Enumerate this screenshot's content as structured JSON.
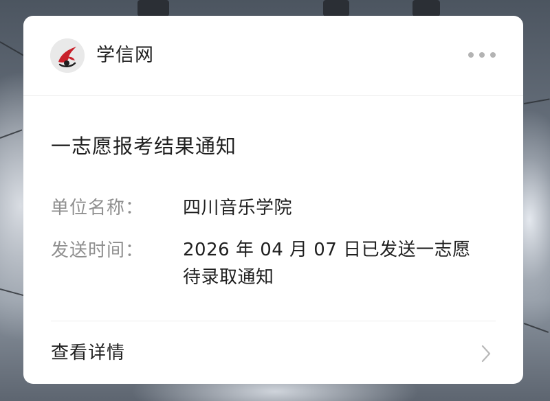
{
  "card": {
    "brand_name": "学信网",
    "more_icon": "more-dots-icon",
    "title": "一志愿报考结果通知",
    "fields": [
      {
        "label": "单位名称：",
        "value_lines": [
          "四川音乐学院"
        ]
      },
      {
        "label": "发送时间：",
        "value_lines": [
          "2026 年 04 月 07 日已发送一志愿",
          "待录取通知"
        ]
      }
    ],
    "footer": {
      "label": "查看详情",
      "icon": "chevron-right-icon"
    }
  },
  "colors": {
    "logo_red": "#c8202a",
    "text_primary": "#1f1f1f",
    "text_secondary": "#8f8f8f",
    "divider": "#ececec"
  }
}
